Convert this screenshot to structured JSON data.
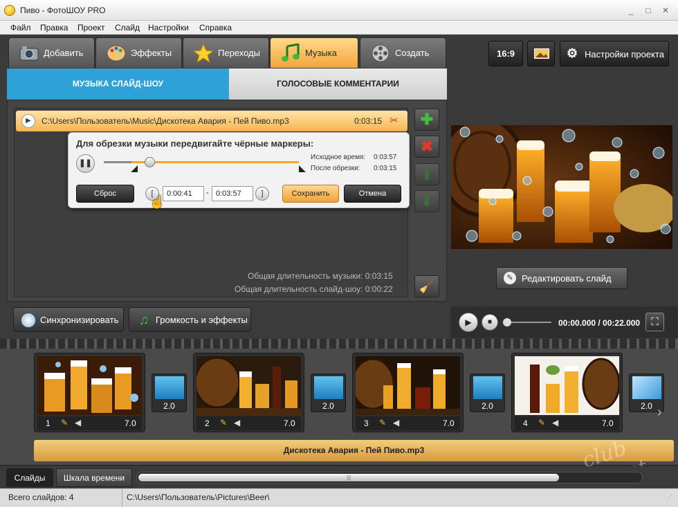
{
  "window": {
    "title": "Пиво - ФотоШОУ PRO",
    "controls": [
      "_",
      "□",
      "✕"
    ]
  },
  "menu": [
    "Файл",
    "Правка",
    "Проект",
    "Слайд",
    "Настройки",
    "Справка"
  ],
  "tabs": [
    {
      "label": "Добавить",
      "icon": "camera-icon"
    },
    {
      "label": "Эффекты",
      "icon": "palette-icon"
    },
    {
      "label": "Переходы",
      "icon": "star-icon"
    },
    {
      "label": "Музыка",
      "icon": "music-note-icon",
      "active": true
    },
    {
      "label": "Создать",
      "icon": "film-reel-icon"
    }
  ],
  "subtabs": {
    "music": "МУЗЫКА СЛАЙД-ШОУ",
    "voice": "ГОЛОСОВЫЕ КОММЕНТАРИИ"
  },
  "track": {
    "path": "C:\\Users\\Пользователь\\Music\\Дискотека Авария - Пей Пиво.mp3",
    "duration": "0:03:15"
  },
  "trim": {
    "header": "Для обрезки музыки передвигайте чёрные маркеры:",
    "original_label": "Исходное время:",
    "original_value": "0:03:57",
    "after_label": "После обрезки:",
    "after_value": "0:03:15",
    "start_time": "0:00:41",
    "end_time": "0:03:57",
    "dash": "-",
    "reset": "Сброс",
    "save": "Сохранить",
    "cancel": "Отмена",
    "open_bracket": "[",
    "close_bracket": "]"
  },
  "stats": {
    "music_total": "Общая длительность музыки: 0:03:15",
    "show_total": "Общая длительность слайд-шоу: 0:00:22"
  },
  "bottom_buttons": {
    "sync": "Синхронизировать",
    "volume": "Громкость и эффекты"
  },
  "right": {
    "aspect": "16:9",
    "settings": "Настройки проекта",
    "edit_slide": "Редактировать слайд",
    "time": "00:00.000 / 00:22.000"
  },
  "slides": [
    {
      "num": "1",
      "dur": "7.0"
    },
    {
      "num": "2",
      "dur": "7.0"
    },
    {
      "num": "3",
      "dur": "7.0"
    },
    {
      "num": "4",
      "dur": "7.0"
    }
  ],
  "transitions": [
    "2.0",
    "2.0",
    "2.0",
    "2.0"
  ],
  "audio_track": "Дискотека Авария - Пей Пиво.mp3",
  "view_tabs": {
    "slides": "Слайды",
    "timeline": "Шкала времени"
  },
  "status": {
    "count": "Всего слайдов: 4",
    "path": "C:\\Users\\Пользователь\\Pictures\\Beer\\"
  },
  "watermark": "club Sovet",
  "colors": {
    "accent_orange": "#f4a53c",
    "accent_blue": "#2ea2d6",
    "add_green": "#3fb43a",
    "delete_red": "#d93a2b"
  }
}
